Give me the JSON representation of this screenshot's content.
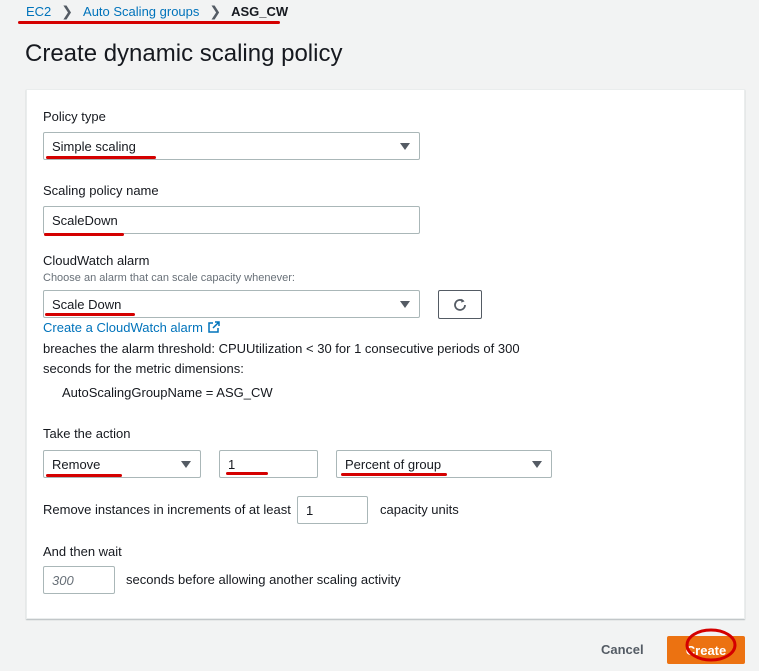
{
  "breadcrumb": {
    "items": [
      "EC2",
      "Auto Scaling groups"
    ],
    "current": "ASG_CW"
  },
  "page": {
    "title": "Create dynamic scaling policy"
  },
  "form": {
    "policy_type": {
      "label": "Policy type",
      "value": "Simple scaling"
    },
    "policy_name": {
      "label": "Scaling policy name",
      "value": "ScaleDown"
    },
    "cloudwatch": {
      "label": "CloudWatch alarm",
      "description": "Choose an alarm that can scale capacity whenever:",
      "value": "Scale Down",
      "create_link": "Create a CloudWatch alarm",
      "breach_line1": "breaches the alarm threshold: CPUUtilization < 30 for 1 consecutive periods of 300",
      "breach_line2": "seconds for the metric dimensions:",
      "dimension": "AutoScalingGroupName = ASG_CW"
    },
    "action": {
      "label": "Take the action",
      "operation": "Remove",
      "amount": "1",
      "unit": "Percent of group"
    },
    "increments": {
      "label": "Remove instances in increments of at least",
      "value": "1",
      "suffix": "capacity units"
    },
    "wait": {
      "label": "And then wait",
      "placeholder": "300",
      "suffix": "seconds before allowing another scaling activity"
    }
  },
  "footer": {
    "cancel_label": "Cancel",
    "create_label": "Create"
  },
  "colors": {
    "accent": "#ec7211",
    "link": "#0073bb",
    "annotation": "#d40000"
  },
  "icons": {
    "refresh": "refresh-icon",
    "external_link": "external-link-icon",
    "breadcrumb_separator": "chevron-right-icon"
  }
}
